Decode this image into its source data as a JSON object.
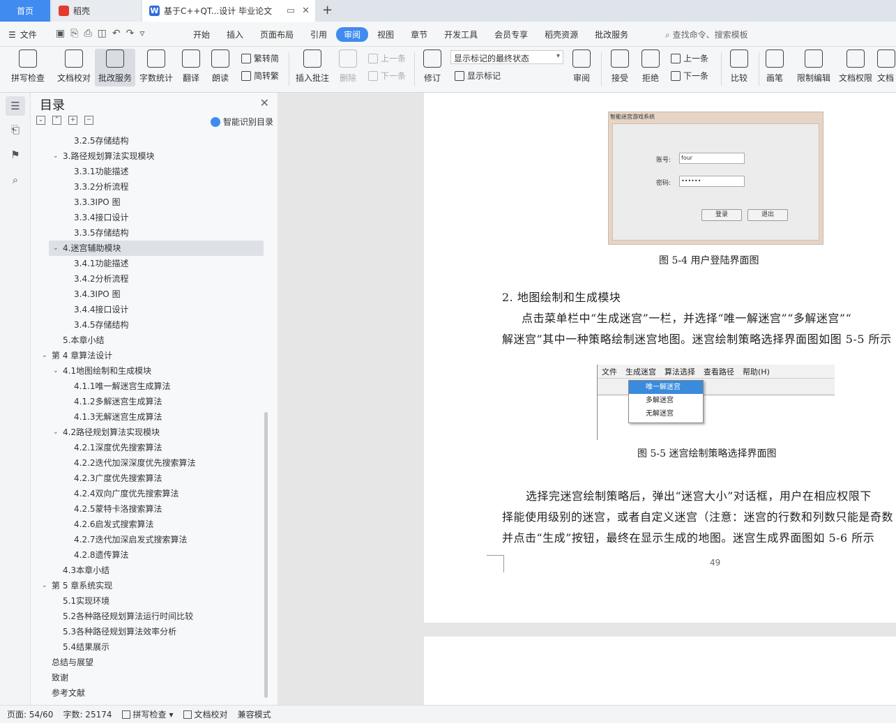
{
  "tabs": {
    "home": "首页",
    "daoke": "稻壳",
    "doc": "基于C++QT...设计 毕业论文"
  },
  "menu": {
    "file": "文件",
    "items": [
      "开始",
      "插入",
      "页面布局",
      "引用",
      "审阅",
      "视图",
      "章节",
      "开发工具",
      "会员专享",
      "稻壳资源",
      "批改服务"
    ],
    "active": "审阅",
    "search": "查找命令、搜索模板"
  },
  "ribbon": {
    "spell": "拼写检查",
    "proof": "文档校对",
    "review_service": "批改服务",
    "wordcount": "字数统计",
    "translate": "翻译",
    "read": "朗读",
    "trad": "繁转简",
    "simp": "简转繁",
    "insert_comment": "插入批注",
    "delete": "删除",
    "prev": "上一条",
    "next": "下一条",
    "track": "修订",
    "show_state": "显示标记的最终状态",
    "show_marks": "显示标记",
    "review": "审阅",
    "accept": "接受",
    "reject": "拒绝",
    "prev2": "上一条",
    "next2": "下一条",
    "compare": "比较",
    "pen": "画笔",
    "restrict": "限制编辑",
    "perm": "文档权限",
    "more": "文档"
  },
  "toc": {
    "title": "目录",
    "smart": "智能识别目录",
    "items": [
      {
        "label": "3.2.5存储结构",
        "level": 3
      },
      {
        "label": "3.路径规划算法实现模块",
        "level": 2,
        "caret": "v"
      },
      {
        "label": "3.3.1功能描述",
        "level": 3
      },
      {
        "label": "3.3.2分析流程",
        "level": 3
      },
      {
        "label": "3.3.3IPO 图",
        "level": 3
      },
      {
        "label": "3.3.4接口设计",
        "level": 3
      },
      {
        "label": "3.3.5存储结构",
        "level": 3
      },
      {
        "label": "4.迷宫辅助模块",
        "level": 2,
        "caret": "v",
        "highlight": true
      },
      {
        "label": "3.4.1功能描述",
        "level": 3
      },
      {
        "label": "3.4.2分析流程",
        "level": 3
      },
      {
        "label": "3.4.3IPO 图",
        "level": 3
      },
      {
        "label": "3.4.4接口设计",
        "level": 3
      },
      {
        "label": "3.4.5存储结构",
        "level": 3
      },
      {
        "label": "5.本章小结",
        "level": 2
      },
      {
        "label": "第 4 章算法设计",
        "level": 1,
        "caret": "v"
      },
      {
        "label": "4.1地图绘制和生成模块",
        "level": 2,
        "caret": "v"
      },
      {
        "label": "4.1.1唯一解迷宫生成算法",
        "level": 3
      },
      {
        "label": "4.1.2多解迷宫生成算法",
        "level": 3
      },
      {
        "label": "4.1.3无解迷宫生成算法",
        "level": 3
      },
      {
        "label": "4.2路径规划算法实现模块",
        "level": 2,
        "caret": "v"
      },
      {
        "label": "4.2.1深度优先搜索算法",
        "level": 3
      },
      {
        "label": "4.2.2迭代加深深度优先搜索算法",
        "level": 3
      },
      {
        "label": "4.2.3广度优先搜索算法",
        "level": 3
      },
      {
        "label": "4.2.4双向广度优先搜索算法",
        "level": 3
      },
      {
        "label": "4.2.5蒙特卡洛搜索算法",
        "level": 3
      },
      {
        "label": "4.2.6启发式搜索算法",
        "level": 3
      },
      {
        "label": "4.2.7迭代加深启发式搜索算法",
        "level": 3
      },
      {
        "label": "4.2.8遗传算法",
        "level": 3
      },
      {
        "label": "4.3本章小结",
        "level": 2
      },
      {
        "label": "第 5 章系统实现",
        "level": 1,
        "caret": "v"
      },
      {
        "label": "5.1实现环境",
        "level": 2
      },
      {
        "label": "5.2各种路径规划算法运行时间比较",
        "level": 2
      },
      {
        "label": "5.3各种路径规划算法效率分析",
        "level": 2
      },
      {
        "label": "5.4结果展示",
        "level": 2
      },
      {
        "label": "总结与展望",
        "level": 1
      },
      {
        "label": "致谢",
        "level": 1
      },
      {
        "label": "参考文献",
        "level": 1
      }
    ]
  },
  "doc": {
    "fig1": {
      "window_title": "智能迷宫游戏系统",
      "account_label": "账号:",
      "account_value": "four",
      "password_label": "密码:",
      "password_value": "••••••",
      "login": "登录",
      "exit": "退出"
    },
    "caption1": "图 5-4    用户登陆界面图",
    "heading2": "2.   地图绘制和生成模块",
    "para1_l1": "点击菜单栏中“生成迷宫”一栏，并选择“唯一解迷宫”“多解迷宫”“",
    "para1_l2": "解迷宫”其中一种策略绘制迷宫地图。迷宫绘制策略选择界面图如图 5-5 所示",
    "fig2": {
      "menus": [
        "文件",
        "生成迷宫",
        "算法选择",
        "查看路径",
        "帮助(H)"
      ],
      "options": [
        "唯一解迷宫",
        "多解迷宫",
        "无解迷宫"
      ]
    },
    "caption2": "图 5-5    迷宫绘制策略选择界面图",
    "para2_l1": "选择完迷宫绘制策略后，弹出“迷宫大小”对话框，用户在相应权限下",
    "para2_l2": "择能使用级别的迷宫，或者自定义迷宫（注意：迷宫的行数和列数只能是奇数",
    "para2_l3": "并点击“生成”按钮，最终在显示生成的地图。迷宫生成界面图如 5-6 所示",
    "page_number": "49"
  },
  "status": {
    "page": "页面: 54/60",
    "words": "字数: 25174",
    "spell": "拼写检查",
    "proof": "文档校对",
    "compat": "兼容模式"
  }
}
